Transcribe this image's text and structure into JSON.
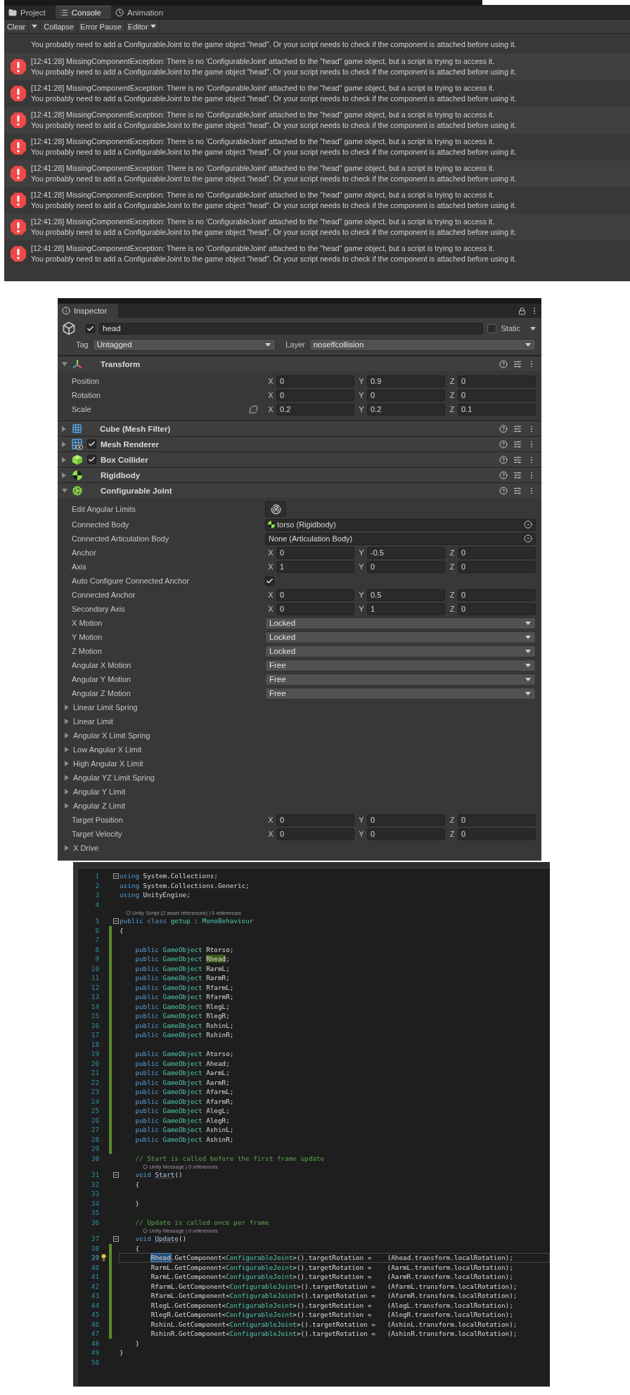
{
  "console": {
    "tabs": [
      {
        "label": "Project",
        "selected": false
      },
      {
        "label": "Console",
        "selected": true
      },
      {
        "label": "Animation",
        "selected": false
      }
    ],
    "toolbar": {
      "clear": "Clear",
      "toggles": [
        {
          "label": "Collapse",
          "on": false
        },
        {
          "label": "Error Pause",
          "on": false
        }
      ],
      "editor": "Editor"
    },
    "entries": [
      {
        "detail": "You probably need to add a ConfigurableJoint to the game object \"head\". Or your script needs to check if the component is attached before using it."
      },
      {
        "message": "[12:41:28] MissingComponentException: There is no 'ConfigurableJoint' attached to the \"head\" game object, but a script is trying to access it.",
        "detail": "You probably need to add a ConfigurableJoint to the game object \"head\". Or your script needs to check if the component is attached before using it."
      },
      {
        "message": "[12:41:28] MissingComponentException: There is no 'ConfigurableJoint' attached to the \"head\" game object, but a script is trying to access it.",
        "detail": "You probably need to add a ConfigurableJoint to the game object \"head\". Or your script needs to check if the component is attached before using it."
      },
      {
        "message": "[12:41:28] MissingComponentException: There is no 'ConfigurableJoint' attached to the \"head\" game object, but a script is trying to access it.",
        "detail": "You probably need to add a ConfigurableJoint to the game object \"head\". Or your script needs to check if the component is attached before using it."
      },
      {
        "message": "[12:41:28] MissingComponentException: There is no 'ConfigurableJoint' attached to the \"head\" game object, but a script is trying to access it.",
        "detail": "You probably need to add a ConfigurableJoint to the game object \"head\". Or your script needs to check if the component is attached before using it."
      },
      {
        "message": "[12:41:28] MissingComponentException: There is no 'ConfigurableJoint' attached to the \"head\" game object, but a script is trying to access it.",
        "detail": "You probably need to add a ConfigurableJoint to the game object \"head\". Or your script needs to check if the component is attached before using it."
      },
      {
        "message": "[12:41:28] MissingComponentException: There is no 'ConfigurableJoint' attached to the \"head\" game object, but a script is trying to access it.",
        "detail": "You probably need to add a ConfigurableJoint to the game object \"head\". Or your script needs to check if the component is attached before using it."
      },
      {
        "message": "[12:41:28] MissingComponentException: There is no 'ConfigurableJoint' attached to the \"head\" game object, but a script is trying to access it.",
        "detail": "You probably need to add a ConfigurableJoint to the game object \"head\". Or your script needs to check if the component is attached before using it."
      },
      {
        "message": "[12:41:28] MissingComponentException: There is no 'ConfigurableJoint' attached to the \"head\" game object, but a script is trying to access it.",
        "detail": "You probably need to add a ConfigurableJoint to the game object \"head\". Or your script needs to check if the component is attached before using it."
      }
    ]
  },
  "inspector": {
    "tab": "Inspector",
    "object": {
      "active": true,
      "name": "head",
      "static": false,
      "static_label": "Static",
      "tag_label": "Tag",
      "tag": "Untagged",
      "layer_label": "Layer",
      "layer": "noselfcollision"
    },
    "components": [
      {
        "kind": "transform",
        "name": "Transform",
        "expanded": true,
        "rows": [
          {
            "kind": "vector",
            "label": "Position",
            "fields": [
              {
                "axis": "X",
                "value": "0"
              },
              {
                "axis": "Y",
                "value": "0.9"
              },
              {
                "axis": "Z",
                "value": "0"
              }
            ]
          },
          {
            "kind": "vector",
            "label": "Rotation",
            "fields": [
              {
                "axis": "X",
                "value": "0"
              },
              {
                "axis": "Y",
                "value": "0"
              },
              {
                "axis": "Z",
                "value": "0"
              }
            ]
          },
          {
            "kind": "vector",
            "label": "Scale",
            "linked": false,
            "fields": [
              {
                "axis": "X",
                "value": "0.2"
              },
              {
                "axis": "Y",
                "value": "0.2"
              },
              {
                "axis": "Z",
                "value": "0.1"
              }
            ]
          }
        ]
      },
      {
        "kind": "mesh_filter",
        "name": "Cube (Mesh Filter)",
        "expanded": false
      },
      {
        "kind": "mesh_renderer",
        "name": "Mesh Renderer",
        "expanded": false,
        "enabled": true
      },
      {
        "kind": "box_collider",
        "name": "Box Collider",
        "expanded": false,
        "enabled": true
      },
      {
        "kind": "rigidbody",
        "name": "Rigidbody",
        "expanded": false
      },
      {
        "kind": "configurable_joint",
        "name": "Configurable Joint",
        "expanded": true,
        "rows": [
          {
            "kind": "button",
            "label": "Edit Angular Limits"
          },
          {
            "kind": "object",
            "label": "Connected Body",
            "value": "torso (Rigidbody)",
            "assigned": true
          },
          {
            "kind": "object",
            "label": "Connected Articulation Body",
            "value": "None (Articulation Body)",
            "assigned": false
          },
          {
            "kind": "vector",
            "label": "Anchor",
            "fields": [
              {
                "axis": "X",
                "value": "0"
              },
              {
                "axis": "Y",
                "value": "-0.5"
              },
              {
                "axis": "Z",
                "value": "0"
              }
            ]
          },
          {
            "kind": "vector",
            "label": "Axis",
            "fields": [
              {
                "axis": "X",
                "value": "1"
              },
              {
                "axis": "Y",
                "value": "0"
              },
              {
                "axis": "Z",
                "value": "0"
              }
            ]
          },
          {
            "kind": "toggle",
            "label": "Auto Configure Connected Anchor",
            "checked": true
          },
          {
            "kind": "vector",
            "label": "Connected Anchor",
            "fields": [
              {
                "axis": "X",
                "value": "0"
              },
              {
                "axis": "Y",
                "value": "0.5"
              },
              {
                "axis": "Z",
                "value": "0"
              }
            ]
          },
          {
            "kind": "vector",
            "label": "Secondary Axis",
            "fields": [
              {
                "axis": "X",
                "value": "0"
              },
              {
                "axis": "Y",
                "value": "1"
              },
              {
                "axis": "Z",
                "value": "0"
              }
            ]
          },
          {
            "kind": "dropdown",
            "label": "X Motion",
            "value": "Locked"
          },
          {
            "kind": "dropdown",
            "label": "Y Motion",
            "value": "Locked"
          },
          {
            "kind": "dropdown",
            "label": "Z Motion",
            "value": "Locked"
          },
          {
            "kind": "dropdown",
            "label": "Angular X Motion",
            "value": "Free"
          },
          {
            "kind": "dropdown",
            "label": "Angular Y Motion",
            "value": "Free"
          },
          {
            "kind": "dropdown",
            "label": "Angular Z Motion",
            "value": "Free"
          },
          {
            "kind": "foldout",
            "label": "Linear Limit Spring",
            "expanded": false
          },
          {
            "kind": "foldout",
            "label": "Linear Limit",
            "expanded": false
          },
          {
            "kind": "foldout",
            "label": "Angular X Limit Spring",
            "expanded": false
          },
          {
            "kind": "foldout",
            "label": "Low Angular X Limit",
            "expanded": false
          },
          {
            "kind": "foldout",
            "label": "High Angular X Limit",
            "expanded": false
          },
          {
            "kind": "foldout",
            "label": "Angular YZ Limit Spring",
            "expanded": false
          },
          {
            "kind": "foldout",
            "label": "Angular Y Limit",
            "expanded": false
          },
          {
            "kind": "foldout",
            "label": "Angular Z Limit",
            "expanded": false
          },
          {
            "kind": "vector",
            "label": "Target Position",
            "fields": [
              {
                "axis": "X",
                "value": "0"
              },
              {
                "axis": "Y",
                "value": "0"
              },
              {
                "axis": "Z",
                "value": "0"
              }
            ]
          },
          {
            "kind": "vector",
            "label": "Target Velocity",
            "fields": [
              {
                "axis": "X",
                "value": "0"
              },
              {
                "axis": "Y",
                "value": "0"
              },
              {
                "axis": "Z",
                "value": "0"
              }
            ]
          },
          {
            "kind": "foldout",
            "label": "X Drive",
            "expanded": false
          }
        ]
      }
    ]
  },
  "code": {
    "lines": [
      {
        "kind": "code",
        "number": "1",
        "fold": true,
        "changed": false,
        "current": false,
        "tokens": [
          {
            "kind": "keyword",
            "text": "using"
          },
          {
            "kind": "plain",
            "text": " System.Collections;"
          }
        ]
      },
      {
        "kind": "code",
        "number": "2",
        "fold": false,
        "changed": false,
        "current": false,
        "tokens": [
          {
            "kind": "keyword",
            "text": "using"
          },
          {
            "kind": "plain",
            "text": " System.Collections.Generic;"
          }
        ]
      },
      {
        "kind": "code",
        "number": "3",
        "fold": false,
        "changed": false,
        "current": false,
        "tokens": [
          {
            "kind": "keyword",
            "text": "using"
          },
          {
            "kind": "plain",
            "text": " UnityEngine;"
          }
        ]
      },
      {
        "kind": "code",
        "number": "4",
        "fold": false,
        "changed": false,
        "current": false
      },
      {
        "kind": "codelens",
        "text": "Unity Script (2 asset references) | 0 references"
      },
      {
        "kind": "code",
        "number": "5",
        "fold": true,
        "changed": false,
        "current": false,
        "tokens": [
          {
            "kind": "keyword",
            "text": "public class "
          },
          {
            "kind": "type",
            "text": "getup"
          },
          {
            "kind": "plain",
            "text": " : "
          },
          {
            "kind": "type",
            "text": "MonoBehaviour"
          }
        ]
      },
      {
        "kind": "code",
        "number": "6",
        "fold": false,
        "changed": true,
        "current": false,
        "tokens": [
          {
            "kind": "plain",
            "text": "{"
          }
        ]
      },
      {
        "kind": "code",
        "number": "7",
        "fold": false,
        "changed": true,
        "current": false
      },
      {
        "kind": "code",
        "number": "8",
        "fold": false,
        "changed": true,
        "current": false,
        "tokens": [
          {
            "kind": "keyword",
            "text": "    public "
          },
          {
            "kind": "type",
            "text": "GameObject"
          },
          {
            "kind": "plain",
            "text": " Rtorso;"
          }
        ]
      },
      {
        "kind": "code",
        "number": "9",
        "fold": false,
        "changed": true,
        "current": false,
        "tokens": [
          {
            "kind": "keyword",
            "text": "    public "
          },
          {
            "kind": "type",
            "text": "GameObject"
          },
          {
            "kind": "match",
            "text": " Rhead"
          },
          {
            "kind": "plain",
            "text": ";"
          }
        ]
      },
      {
        "kind": "code",
        "number": "10",
        "fold": false,
        "changed": true,
        "current": false,
        "tokens": [
          {
            "kind": "keyword",
            "text": "    public "
          },
          {
            "kind": "type",
            "text": "GameObject"
          },
          {
            "kind": "plain",
            "text": " RarmL;"
          }
        ]
      },
      {
        "kind": "code",
        "number": "11",
        "fold": false,
        "changed": true,
        "current": false,
        "tokens": [
          {
            "kind": "keyword",
            "text": "    public "
          },
          {
            "kind": "type",
            "text": "GameObject"
          },
          {
            "kind": "plain",
            "text": " RarmR;"
          }
        ]
      },
      {
        "kind": "code",
        "number": "12",
        "fold": false,
        "changed": true,
        "current": false,
        "tokens": [
          {
            "kind": "keyword",
            "text": "    public "
          },
          {
            "kind": "type",
            "text": "GameObject"
          },
          {
            "kind": "plain",
            "text": " RfarmL;"
          }
        ]
      },
      {
        "kind": "code",
        "number": "13",
        "fold": false,
        "changed": true,
        "current": false,
        "tokens": [
          {
            "kind": "keyword",
            "text": "    public "
          },
          {
            "kind": "type",
            "text": "GameObject"
          },
          {
            "kind": "plain",
            "text": " RfarmR;"
          }
        ]
      },
      {
        "kind": "code",
        "number": "14",
        "fold": false,
        "changed": true,
        "current": false,
        "tokens": [
          {
            "kind": "keyword",
            "text": "    public "
          },
          {
            "kind": "type",
            "text": "GameObject"
          },
          {
            "kind": "plain",
            "text": " RlegL;"
          }
        ]
      },
      {
        "kind": "code",
        "number": "15",
        "fold": false,
        "changed": true,
        "current": false,
        "tokens": [
          {
            "kind": "keyword",
            "text": "    public "
          },
          {
            "kind": "type",
            "text": "GameObject"
          },
          {
            "kind": "plain",
            "text": " RlegR;"
          }
        ]
      },
      {
        "kind": "code",
        "number": "16",
        "fold": false,
        "changed": true,
        "current": false,
        "tokens": [
          {
            "kind": "keyword",
            "text": "    public "
          },
          {
            "kind": "type",
            "text": "GameObject"
          },
          {
            "kind": "plain",
            "text": " RshinL;"
          }
        ]
      },
      {
        "kind": "code",
        "number": "17",
        "fold": false,
        "changed": true,
        "current": false,
        "tokens": [
          {
            "kind": "keyword",
            "text": "    public "
          },
          {
            "kind": "type",
            "text": "GameObject"
          },
          {
            "kind": "plain",
            "text": " RshinR;"
          }
        ]
      },
      {
        "kind": "code",
        "number": "18",
        "fold": false,
        "changed": true,
        "current": false
      },
      {
        "kind": "code",
        "number": "19",
        "fold": false,
        "changed": true,
        "current": false,
        "tokens": [
          {
            "kind": "keyword",
            "text": "    public "
          },
          {
            "kind": "type",
            "text": "GameObject"
          },
          {
            "kind": "plain",
            "text": " Atorso;"
          }
        ]
      },
      {
        "kind": "code",
        "number": "20",
        "fold": false,
        "changed": true,
        "current": false,
        "tokens": [
          {
            "kind": "keyword",
            "text": "    public "
          },
          {
            "kind": "type",
            "text": "GameObject"
          },
          {
            "kind": "plain",
            "text": " Ahead;"
          }
        ]
      },
      {
        "kind": "code",
        "number": "21",
        "fold": false,
        "changed": true,
        "current": false,
        "tokens": [
          {
            "kind": "keyword",
            "text": "    public "
          },
          {
            "kind": "type",
            "text": "GameObject"
          },
          {
            "kind": "plain",
            "text": " AarmL;"
          }
        ]
      },
      {
        "kind": "code",
        "number": "22",
        "fold": false,
        "changed": true,
        "current": false,
        "tokens": [
          {
            "kind": "keyword",
            "text": "    public "
          },
          {
            "kind": "type",
            "text": "GameObject"
          },
          {
            "kind": "plain",
            "text": " AarmR;"
          }
        ]
      },
      {
        "kind": "code",
        "number": "23",
        "fold": false,
        "changed": true,
        "current": false,
        "tokens": [
          {
            "kind": "keyword",
            "text": "    public "
          },
          {
            "kind": "type",
            "text": "GameObject"
          },
          {
            "kind": "plain",
            "text": " AfarmL;"
          }
        ]
      },
      {
        "kind": "code",
        "number": "24",
        "fold": false,
        "changed": true,
        "current": false,
        "tokens": [
          {
            "kind": "keyword",
            "text": "    public "
          },
          {
            "kind": "type",
            "text": "GameObject"
          },
          {
            "kind": "plain",
            "text": " AfarmR;"
          }
        ]
      },
      {
        "kind": "code",
        "number": "25",
        "fold": false,
        "changed": true,
        "current": false,
        "tokens": [
          {
            "kind": "keyword",
            "text": "    public "
          },
          {
            "kind": "type",
            "text": "GameObject"
          },
          {
            "kind": "plain",
            "text": " AlegL;"
          }
        ]
      },
      {
        "kind": "code",
        "number": "26",
        "fold": false,
        "changed": true,
        "current": false,
        "tokens": [
          {
            "kind": "keyword",
            "text": "    public "
          },
          {
            "kind": "type",
            "text": "GameObject"
          },
          {
            "kind": "plain",
            "text": " AlegR;"
          }
        ]
      },
      {
        "kind": "code",
        "number": "27",
        "fold": false,
        "changed": true,
        "current": false,
        "tokens": [
          {
            "kind": "keyword",
            "text": "    public "
          },
          {
            "kind": "type",
            "text": "GameObject"
          },
          {
            "kind": "plain",
            "text": " AshinL;"
          }
        ]
      },
      {
        "kind": "code",
        "number": "28",
        "fold": false,
        "changed": true,
        "current": false,
        "tokens": [
          {
            "kind": "keyword",
            "text": "    public "
          },
          {
            "kind": "type",
            "text": "GameObject"
          },
          {
            "kind": "plain",
            "text": " AshinR;"
          }
        ]
      },
      {
        "kind": "code",
        "number": "29",
        "fold": false,
        "changed": true,
        "current": false
      },
      {
        "kind": "code",
        "number": "30",
        "fold": false,
        "changed": false,
        "current": false,
        "tokens": [
          {
            "kind": "comment",
            "text": "    // Start is called before the first frame update"
          }
        ]
      },
      {
        "kind": "codelens",
        "text": "Unity Message | 0 references"
      },
      {
        "kind": "code",
        "number": "31",
        "fold": true,
        "changed": false,
        "current": false,
        "tokens": [
          {
            "kind": "keyword",
            "text": "    void "
          },
          {
            "kind": "method",
            "text": "Start"
          },
          {
            "kind": "plain",
            "text": "()"
          }
        ]
      },
      {
        "kind": "code",
        "number": "32",
        "fold": false,
        "changed": false,
        "current": false,
        "tokens": [
          {
            "kind": "plain",
            "text": "    {"
          }
        ]
      },
      {
        "kind": "code",
        "number": "33",
        "fold": false,
        "changed": false,
        "current": false
      },
      {
        "kind": "code",
        "number": "34",
        "fold": false,
        "changed": false,
        "current": false,
        "tokens": [
          {
            "kind": "plain",
            "text": "    }"
          }
        ]
      },
      {
        "kind": "code",
        "number": "35",
        "fold": false,
        "changed": false,
        "current": false
      },
      {
        "kind": "code",
        "number": "36",
        "fold": false,
        "changed": false,
        "current": false,
        "tokens": [
          {
            "kind": "comment",
            "text": "    // Update is called once per frame"
          }
        ]
      },
      {
        "kind": "codelens",
        "text": "Unity Message | 0 references"
      },
      {
        "kind": "code",
        "number": "37",
        "fold": true,
        "changed": false,
        "current": false,
        "tokens": [
          {
            "kind": "keyword",
            "text": "    void "
          },
          {
            "kind": "method",
            "text": "Update"
          },
          {
            "kind": "plain",
            "text": "()"
          }
        ]
      },
      {
        "kind": "code",
        "number": "38",
        "fold": false,
        "changed": true,
        "current": false,
        "tokens": [
          {
            "kind": "plain",
            "text": "    {"
          }
        ]
      },
      {
        "kind": "code",
        "number": "39",
        "fold": false,
        "changed": true,
        "current": true,
        "lightbulb": true,
        "tokens": [
          {
            "kind": "selection",
            "text": "        Rhead"
          },
          {
            "kind": "plain",
            "text": ".GetComponent<"
          },
          {
            "kind": "type",
            "text": "ConfigurableJoint"
          },
          {
            "kind": "plain",
            "text": ">().targetRotation =    (Ahead.transform.localRotation);"
          }
        ]
      },
      {
        "kind": "code",
        "number": "40",
        "fold": false,
        "changed": true,
        "current": false,
        "tokens": [
          {
            "kind": "plain",
            "text": "        RarmL.GetComponent<"
          },
          {
            "kind": "type",
            "text": "ConfigurableJoint"
          },
          {
            "kind": "plain",
            "text": ">().targetRotation =    (AarmL.transform.localRotation);"
          }
        ]
      },
      {
        "kind": "code",
        "number": "41",
        "fold": false,
        "changed": true,
        "current": false,
        "tokens": [
          {
            "kind": "plain",
            "text": "        RarmL.GetComponent<"
          },
          {
            "kind": "type",
            "text": "ConfigurableJoint"
          },
          {
            "kind": "plain",
            "text": ">().targetRotation =    (AarmR.transform.localRotation);"
          }
        ]
      },
      {
        "kind": "code",
        "number": "42",
        "fold": false,
        "changed": true,
        "current": false,
        "tokens": [
          {
            "kind": "plain",
            "text": "        RfarmL.GetComponent<"
          },
          {
            "kind": "type",
            "text": "ConfigurableJoint"
          },
          {
            "kind": "plain",
            "text": ">().targetRotation =   (AfarmL.transform.localRotation);"
          }
        ]
      },
      {
        "kind": "code",
        "number": "43",
        "fold": false,
        "changed": true,
        "current": false,
        "tokens": [
          {
            "kind": "plain",
            "text": "        RfarmL.GetComponent<"
          },
          {
            "kind": "type",
            "text": "ConfigurableJoint"
          },
          {
            "kind": "plain",
            "text": ">().targetRotation =   (AfarmR.transform.localRotation);"
          }
        ]
      },
      {
        "kind": "code",
        "number": "44",
        "fold": false,
        "changed": true,
        "current": false,
        "tokens": [
          {
            "kind": "plain",
            "text": "        RlegL.GetComponent<"
          },
          {
            "kind": "type",
            "text": "ConfigurableJoint"
          },
          {
            "kind": "plain",
            "text": ">().targetRotation =    (AlegL.transform.localRotation);"
          }
        ]
      },
      {
        "kind": "code",
        "number": "45",
        "fold": false,
        "changed": true,
        "current": false,
        "tokens": [
          {
            "kind": "plain",
            "text": "        RlegR.GetComponent<"
          },
          {
            "kind": "type",
            "text": "ConfigurableJoint"
          },
          {
            "kind": "plain",
            "text": ">().targetRotation =    (AlegR.transform.localRotation);"
          }
        ]
      },
      {
        "kind": "code",
        "number": "46",
        "fold": false,
        "changed": true,
        "current": false,
        "tokens": [
          {
            "kind": "plain",
            "text": "        RshinL.GetComponent<"
          },
          {
            "kind": "type",
            "text": "ConfigurableJoint"
          },
          {
            "kind": "plain",
            "text": ">().targetRotation =   (AshinL.transform.localRotation);"
          }
        ]
      },
      {
        "kind": "code",
        "number": "47",
        "fold": false,
        "changed": true,
        "current": false,
        "tokens": [
          {
            "kind": "plain",
            "text": "        RshinR.GetComponent<"
          },
          {
            "kind": "type",
            "text": "ConfigurableJoint"
          },
          {
            "kind": "plain",
            "text": ">().targetRotation =   (AshinR.transform.localRotation);"
          }
        ]
      },
      {
        "kind": "code",
        "number": "48",
        "fold": false,
        "changed": false,
        "current": false,
        "tokens": [
          {
            "kind": "plain",
            "text": "    }"
          }
        ]
      },
      {
        "kind": "code",
        "number": "49",
        "fold": false,
        "changed": false,
        "current": false,
        "tokens": [
          {
            "kind": "plain",
            "text": "}"
          }
        ]
      },
      {
        "kind": "code",
        "number": "50",
        "fold": false,
        "changed": false,
        "current": false
      }
    ]
  }
}
